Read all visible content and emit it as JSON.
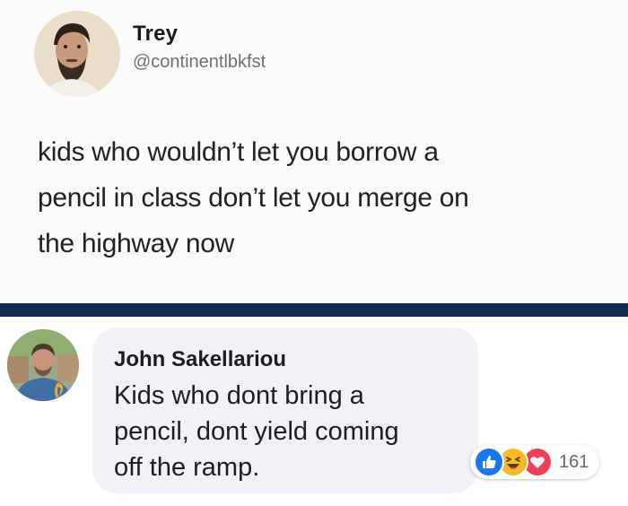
{
  "tweet": {
    "name": "Trey",
    "handle": "@continentlbkfst",
    "lines": [
      "kids who wouldn’t let you borrow a",
      "pencil in class don’t let you merge on",
      "the highway now"
    ]
  },
  "comment": {
    "author": "John Sakellariou",
    "lines": [
      "Kids who dont bring a",
      "pencil,  dont yield coming",
      "off the ramp."
    ],
    "reactions": {
      "icons": [
        "like-icon",
        "haha-icon",
        "love-icon"
      ],
      "count": "161"
    }
  },
  "colors": {
    "divider": "#0f2d52",
    "bubble": "#f0f2f5",
    "like": "#1877f2",
    "haha": "#f7b928",
    "love": "#f33e58"
  }
}
